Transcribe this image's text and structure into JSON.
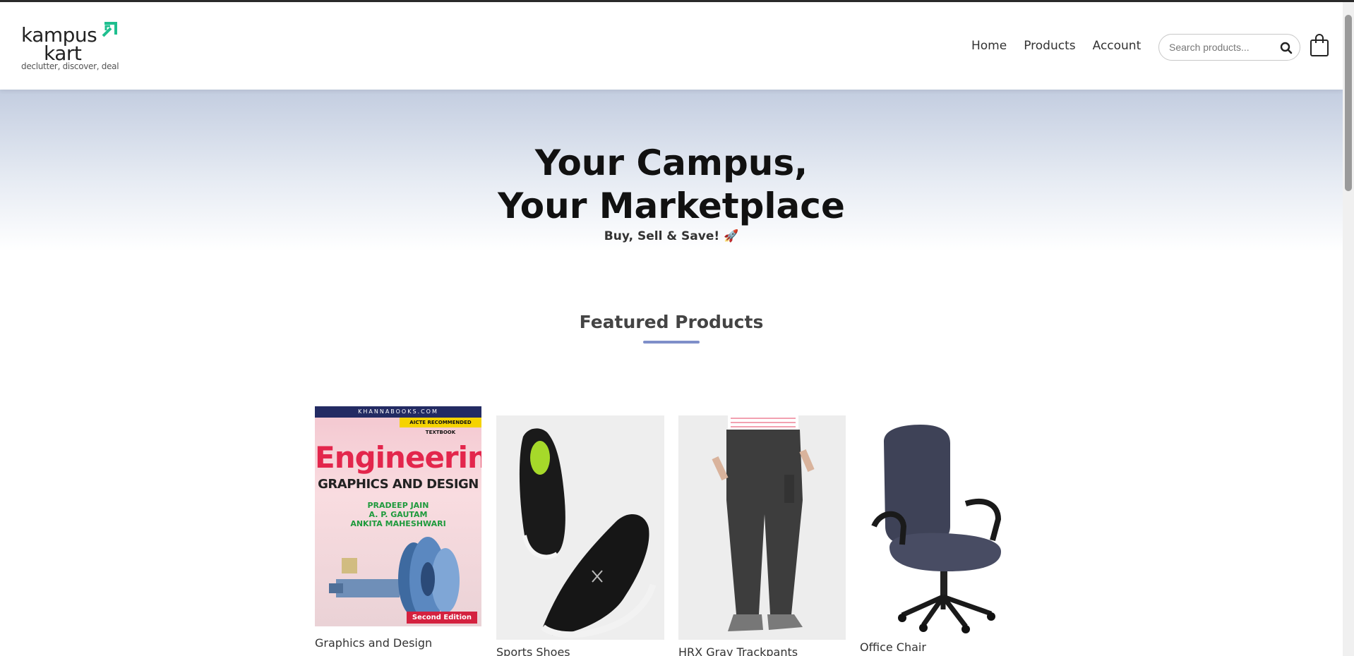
{
  "brand": {
    "name_line1": "kampus",
    "name_line2": "kart",
    "tagline": "declutter, discover, deal",
    "accent_color": "#1fbf8f"
  },
  "nav": {
    "items": [
      {
        "label": "Home"
      },
      {
        "label": "Products"
      },
      {
        "label": "Account"
      }
    ]
  },
  "search": {
    "placeholder": "Search products...",
    "value": "",
    "icon": "search-icon"
  },
  "cart": {
    "icon": "shopping-bag-icon"
  },
  "hero": {
    "title_line1": "Your Campus,",
    "title_line2": "Your Marketplace",
    "subtitle": "Buy, Sell & Save! 🚀",
    "gradient_top": "#c3cde0"
  },
  "featured": {
    "title": "Featured Products",
    "underline_color": "#7f8fc9",
    "products": [
      {
        "name": "Graphics and Design",
        "cover": {
          "publisher": "KHANNABOOKS.COM",
          "badge": "AICTE RECOMMENDED TEXTBOOK",
          "title_main": "Engineering",
          "title_sub": "GRAPHICS AND DESIGN",
          "authors": [
            "PRADEEP JAIN",
            "A. P. GAUTAM",
            "ANKITA MAHESHWARI"
          ],
          "edition": "Second Edition"
        }
      },
      {
        "name": "Sports Shoes"
      },
      {
        "name": "HRX Gray Trackpants"
      },
      {
        "name": "Office Chair"
      }
    ]
  }
}
